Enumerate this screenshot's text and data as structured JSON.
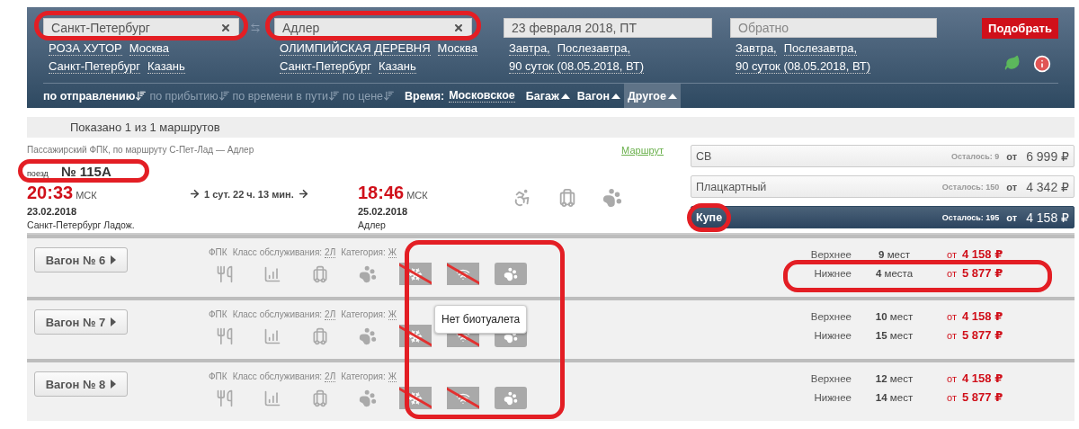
{
  "header": {
    "from_field": {
      "value": "Санкт-Петербург",
      "circled": true
    },
    "to_field": {
      "value": "Адлер",
      "circled": true
    },
    "date_field": {
      "value": "23 февраля 2018, ПТ"
    },
    "return_field": {
      "placeholder": "Обратно"
    },
    "submit": "Подобрать",
    "from_suggestions": [
      [
        "РОЗА ХУТОР",
        "Москва"
      ],
      [
        "Санкт-Петербург",
        "Казань"
      ]
    ],
    "to_suggestions": [
      [
        "ОЛИМПИЙСКАЯ ДЕРЕВНЯ",
        "Москва"
      ],
      [
        "Санкт-Петербург",
        "Казань"
      ]
    ],
    "date_shortcuts": [
      [
        "Завтра,",
        "Послезавтра,"
      ],
      [
        "90 суток (08.05.2018, ВТ)"
      ]
    ],
    "return_shortcuts": [
      [
        "Завтра,",
        "Послезавтра,"
      ],
      [
        "90 суток (08.05.2018, ВТ)"
      ]
    ]
  },
  "sort_bar": {
    "sorts": [
      {
        "label": "по отправлению",
        "selected": true
      },
      {
        "label": "по прибытию",
        "selected": false
      },
      {
        "label": "по времени в пути",
        "selected": false
      },
      {
        "label": "по цене",
        "selected": false
      }
    ],
    "time_label": "Время:",
    "time_value": "Московское",
    "filters": [
      {
        "label": "Багаж",
        "selected": false
      },
      {
        "label": "Вагон",
        "selected": false
      },
      {
        "label": "Другое",
        "selected": true
      }
    ]
  },
  "results_count": "Показано 1 из 1 маршрутов",
  "train": {
    "description": "Пассажирский ФПК, по маршруту С-Пет-Лад — Адлер",
    "route_link": "Маршрут",
    "number_label": "поезд",
    "number": "№ 115А",
    "number_circled": true,
    "departure": {
      "time": "20:33",
      "zone": "МСК",
      "date": "23.02.2018",
      "station": "Санкт-Петербург Ладож."
    },
    "duration": "1 сут. 22 ч. 13 мин.",
    "arrival": {
      "time": "18:46",
      "zone": "МСК",
      "date": "25.02.2018",
      "station": "Адлер"
    },
    "features": [
      {
        "kind": "wheelchair"
      },
      {
        "kind": "luggage"
      },
      {
        "kind": "paw"
      }
    ],
    "classes": [
      {
        "name": "СВ",
        "left": "Осталось: 9",
        "prefix": "от",
        "price": "6 999 ₽",
        "selected": false,
        "circled": false
      },
      {
        "name": "Плацкартный",
        "left": "Осталось: 150",
        "prefix": "от",
        "price": "4 342 ₽",
        "selected": false,
        "circled": false
      },
      {
        "name": "Купе",
        "left": "Осталось: 195",
        "prefix": "от",
        "price": "4 158 ₽",
        "selected": true,
        "circled": true
      }
    ]
  },
  "amenities_circled": true,
  "wagons": [
    {
      "button": "Вагон № 6",
      "carrier": "ФПК",
      "service_label": "Класс обслуживания:",
      "service_value": "2Л",
      "category_label": "Категория:",
      "category_value": "Ж",
      "amenities": [
        {
          "kind": "dining",
          "crossed": false
        },
        {
          "kind": "chart",
          "crossed": false
        },
        {
          "kind": "luggage",
          "crossed": false
        },
        {
          "kind": "paw",
          "crossed": false
        },
        {
          "kind": "snowflake",
          "crossed": true
        },
        {
          "kind": "wifi",
          "crossed": true
        },
        {
          "kind": "pet-carrier",
          "crossed": false
        }
      ],
      "seats": [
        {
          "berth": "Верхнее",
          "count": "**9** мест",
          "prefix": "от",
          "price": "4 158 ₽",
          "circled": false
        },
        {
          "berth": "Нижнее",
          "count": "**4** места",
          "prefix": "от",
          "price": "5 877 ₽",
          "circled": true
        }
      ]
    },
    {
      "button": "Вагон № 7",
      "carrier": "ФПК",
      "service_label": "Класс обслуживания:",
      "service_value": "2Л",
      "category_label": "Категория:",
      "category_value": "Ж",
      "tooltip": "Нет биотуалета",
      "amenities": [
        {
          "kind": "dining",
          "crossed": false
        },
        {
          "kind": "chart",
          "crossed": false
        },
        {
          "kind": "luggage",
          "crossed": false
        },
        {
          "kind": "paw",
          "crossed": false
        },
        {
          "kind": "snowflake",
          "crossed": true
        },
        {
          "kind": "wifi",
          "crossed": true
        },
        {
          "kind": "pet-carrier",
          "crossed": false
        }
      ],
      "seats": [
        {
          "berth": "Верхнее",
          "count": "**10** мест",
          "prefix": "от",
          "price": "4 158 ₽",
          "circled": false
        },
        {
          "berth": "Нижнее",
          "count": "**15** мест",
          "prefix": "от",
          "price": "5 877 ₽",
          "circled": false
        }
      ]
    },
    {
      "button": "Вагон № 8",
      "carrier": "ФПК",
      "service_label": "Класс обслуживания:",
      "service_value": "2Л",
      "category_label": "Категория:",
      "category_value": "Ж",
      "amenities": [
        {
          "kind": "dining",
          "crossed": false
        },
        {
          "kind": "chart",
          "crossed": false
        },
        {
          "kind": "luggage",
          "crossed": false
        },
        {
          "kind": "paw",
          "crossed": false
        },
        {
          "kind": "snowflake",
          "crossed": true
        },
        {
          "kind": "wifi",
          "crossed": true
        },
        {
          "kind": "pet-carrier",
          "crossed": false
        }
      ],
      "seats": [
        {
          "berth": "Верхнее",
          "count": "**12** мест",
          "prefix": "от",
          "price": "4 158 ₽",
          "circled": false
        },
        {
          "berth": "Нижнее",
          "count": "**14** мест",
          "prefix": "от",
          "price": "5 877 ₽",
          "circled": false
        }
      ]
    }
  ]
}
